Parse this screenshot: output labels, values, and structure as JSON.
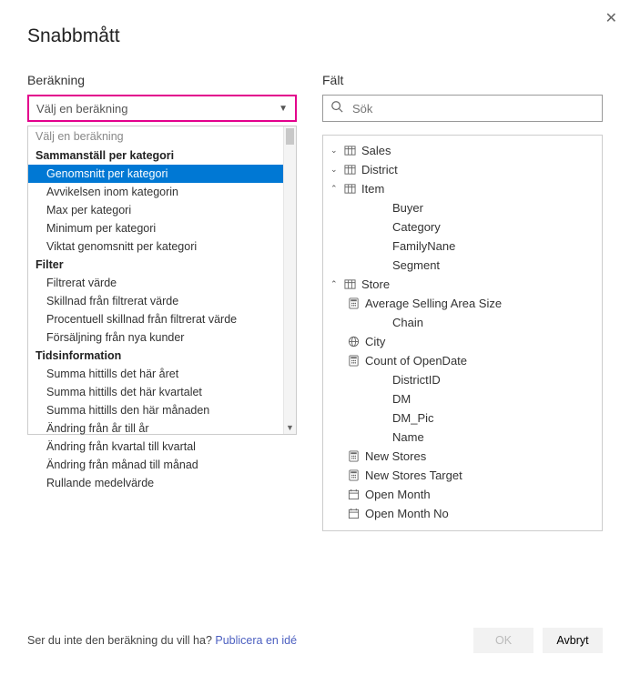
{
  "title": "Snabbmått",
  "left": {
    "label": "Beräkning",
    "combo_value": "Välj en beräkning",
    "dropdown": {
      "prompt": "Välj en beräkning",
      "groups": [
        {
          "label": "Sammanställ per kategori",
          "items": [
            "Genomsnitt per kategori",
            "Avvikelsen inom kategorin",
            "Max per kategori",
            "Minimum per kategori",
            "Viktat genomsnitt per kategori"
          ]
        },
        {
          "label": "Filter",
          "items": [
            "Filtrerat värde",
            "Skillnad från filtrerat värde",
            "Procentuell skillnad från filtrerat värde",
            "Försäljning från nya kunder"
          ]
        },
        {
          "label": "Tidsinformation",
          "items": [
            "Summa hittills det här året",
            "Summa hittills det här kvartalet",
            "Summa hittills den här månaden",
            "Ändring från år till år",
            "Ändring från kvartal till kvartal",
            "Ändring från månad till månad",
            "Rullande medelvärde"
          ]
        }
      ],
      "selected": "Genomsnitt per kategori"
    }
  },
  "right": {
    "label": "Fält",
    "search_placeholder": "Sök",
    "tree": [
      {
        "type": "table",
        "label": "Sales",
        "expanded": true,
        "children": []
      },
      {
        "type": "table",
        "label": "District",
        "expanded": true,
        "children": []
      },
      {
        "type": "table",
        "label": "Item",
        "expanded": false,
        "children": [
          {
            "type": "field",
            "label": "Buyer"
          },
          {
            "type": "field",
            "label": "Category"
          },
          {
            "type": "field",
            "label": "FamilyNane"
          },
          {
            "type": "field",
            "label": "Segment"
          }
        ]
      },
      {
        "type": "table",
        "label": "Store",
        "expanded": false,
        "children": [
          {
            "type": "calc",
            "label": "Average Selling Area Size"
          },
          {
            "type": "field",
            "label": "Chain"
          },
          {
            "type": "geo",
            "label": "City"
          },
          {
            "type": "calc",
            "label": "Count of OpenDate"
          },
          {
            "type": "field",
            "label": "DistrictID"
          },
          {
            "type": "field",
            "label": "DM"
          },
          {
            "type": "field",
            "label": "DM_Pic"
          },
          {
            "type": "field",
            "label": "Name"
          },
          {
            "type": "calc",
            "label": "New Stores"
          },
          {
            "type": "calc",
            "label": "New Stores Target"
          },
          {
            "type": "date",
            "label": "Open Month"
          },
          {
            "type": "date",
            "label": "Open Month No"
          }
        ]
      }
    ]
  },
  "footer": {
    "hint_text": "Ser du inte den beräkning du vill ha? ",
    "hint_link": "Publicera en idé",
    "ok": "OK",
    "cancel": "Avbryt"
  }
}
